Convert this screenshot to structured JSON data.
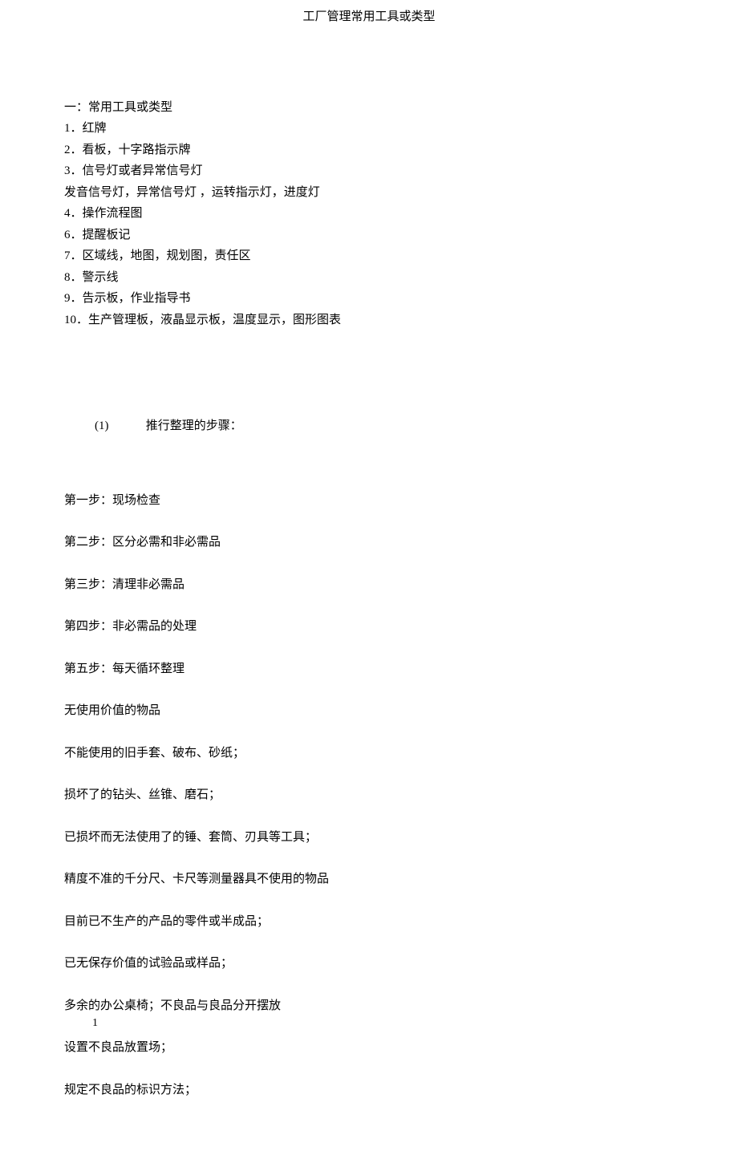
{
  "header": {
    "title": "工厂管理常用工具或类型"
  },
  "section1": {
    "heading": "一：常用工具或类型",
    "items": [
      "1．红牌",
      "2．看板，十字路指示牌",
      "3．信号灯或者异常信号灯",
      "发音信号灯，异常信号灯 ，运转指示灯，进度灯",
      "4．操作流程图",
      "6．提醒板记",
      "7．区域线，地图，规划图，责任区",
      "8．警示线",
      "9．告示板，作业指导书",
      "10．生产管理板，液晶显示板，温度显示，图形图表"
    ]
  },
  "section2": {
    "number": "(1)",
    "title": "推行整理的步骤："
  },
  "steps": [
    "第一步：现场检查",
    "第二步：区分必需和非必需品",
    "第三步：清理非必需品",
    "第四步：非必需品的处理",
    "第五步：每天循环整理"
  ],
  "body": [
    "无使用价值的物品",
    "不能使用的旧手套、破布、砂纸；",
    "损坏了的钻头、丝锥、磨石；",
    "已损坏而无法使用了的锤、套筒、刃具等工具；",
    "精度不准的千分尺、卡尺等测量器具不使用的物品",
    "目前已不生产的产品的零件或半成品；",
    "已无保存价值的试验品或样品；",
    "多余的办公桌椅；不良品与良品分开摆放",
    "设置不良品放置场；",
    "规定不良品的标识方法；"
  ],
  "pageNumber": "1"
}
